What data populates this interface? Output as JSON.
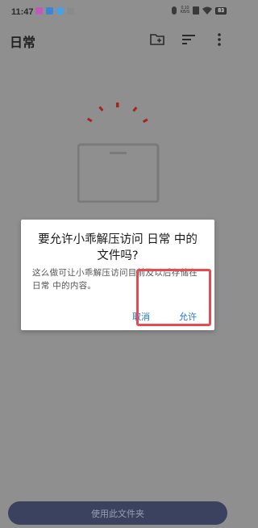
{
  "status_bar": {
    "time": "11:47",
    "net_speed_top": "0.10",
    "net_speed_bottom": "KB/S",
    "battery": "83"
  },
  "app_bar": {
    "title": "日常",
    "icons": [
      "new-folder-icon",
      "sort-icon",
      "more-icon"
    ]
  },
  "dialog": {
    "title": "要允许小乖解压访问 日常 中的文件吗?",
    "message": "这么做可让小乖解压访问目前及以后存储在 日常 中的内容。",
    "cancel_label": "取消",
    "allow_label": "允许"
  },
  "bottom_button": {
    "label": "使用此文件夹"
  },
  "colors": {
    "scrim_background": "#8f8f8f",
    "dialog_button": "#1b73d8",
    "highlight": "#e84a52",
    "bottom_button_bg": "#3a4260",
    "illustration_red": "#a3271f"
  }
}
